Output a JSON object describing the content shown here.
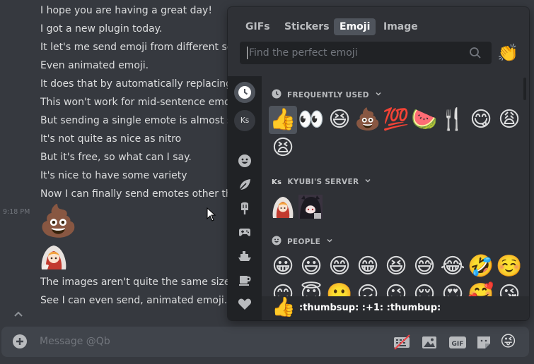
{
  "chat": {
    "messages_top": [
      "I hope you are having a great day!",
      "I got a new plugin today.",
      "It let's me send emoji from different serv",
      "Even animated emoji.",
      "It does that by automatically replacing th",
      "This won't work for mid-sentence emoji",
      "But sending a single emote is almost see",
      "It's not quite as nice as nitro",
      "But it's free, so what  can I say.",
      "It's nice to have some variety",
      "Now I can finally send  emotes other tha"
    ],
    "timestamp": "9:18 PM",
    "poop_emoji": "💩",
    "messages_bottom": [
      "The images aren't quite the same size as",
      "See I can even send, animated emoji."
    ]
  },
  "composer": {
    "placeholder": "Message @Qb",
    "icons": [
      "add-icon",
      "keyboard-slash-icon",
      "image-icon",
      "gif-icon",
      "sticker-icon",
      "emoji-icon"
    ],
    "emoji_button": "😜"
  },
  "picker": {
    "tabs": [
      {
        "label": "GIFs",
        "active": false
      },
      {
        "label": "Stickers",
        "active": false
      },
      {
        "label": "Emoji",
        "active": true
      },
      {
        "label": "Image",
        "active": false
      }
    ],
    "search_placeholder": "Find the perfect emoji",
    "skin_tone_emoji": "👏",
    "rail": {
      "server_initials": "Ks",
      "icons": [
        "clock-icon",
        "server-ks",
        "smiley-icon",
        "leaf-icon",
        "popsicle-icon",
        "gamepad-icon",
        "boat-icon",
        "coffee-icon",
        "heart-icon"
      ]
    },
    "categories": {
      "frequent": {
        "label": "FREQUENTLY USED",
        "emoji_row1": [
          "👍",
          "👀",
          "😆",
          "💩",
          "💯",
          "🍉",
          "🍴",
          "😋",
          "😩"
        ],
        "emoji_row2": [
          "😫"
        ]
      },
      "server": {
        "label": "KYUBI'S SERVER",
        "initials": "Ks"
      },
      "people": {
        "label": "PEOPLE",
        "emoji_row1": [
          "😀",
          "😃",
          "😄",
          "😁",
          "😆",
          "😅",
          "😂",
          "🤣",
          "☺️"
        ],
        "emoji_row2": [
          "😊",
          "😇",
          "🙂",
          "🙃",
          "😉",
          "😌",
          "😍",
          "🥰",
          "😘"
        ]
      }
    },
    "preview": {
      "emoji": "👍",
      "text": ":thumbsup: :+1: :thumbup:"
    },
    "colors": {
      "bg": "#2f3136",
      "rail": "#202225",
      "accent": "#4f545c"
    }
  }
}
